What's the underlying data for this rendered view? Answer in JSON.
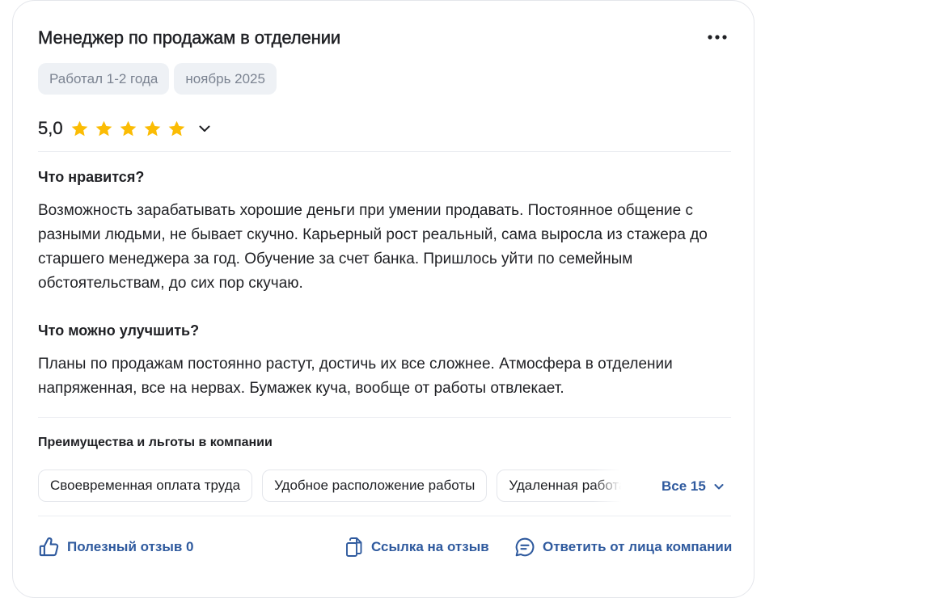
{
  "review": {
    "title": "Менеджер по продажам в отделении",
    "tags": [
      "Работал 1-2 года",
      "ноябрь 2025"
    ],
    "rating": {
      "value": "5,0",
      "stars": 5,
      "star_color": "#fbbc04"
    },
    "pros": {
      "title": "Что нравится?",
      "text": "Возможность зарабатывать хорошие деньги при умении продавать. Постоянное общение с разными людьми, не бывает скучно. Карьерный рост реальный, сама выросла из стажера до старшего менеджера за год. Обучение за счет банка. Пришлось уйти по семейным обстоятельствам, до сих пор скучаю."
    },
    "cons": {
      "title": "Что можно улучшить?",
      "text": "Планы по продажам постоянно растут, достичь их все сложнее. Атмосфера в отделении напряженная, все на нервах. Бумажек куча, вообще от работы отвлекает."
    },
    "benefits": {
      "title": "Преимущества и льготы в компании",
      "items": [
        "Своевременная оплата труда",
        "Удобное расположение работы",
        "Удаленная работа"
      ],
      "show_all_label": "Все 15"
    },
    "actions": {
      "helpful_label": "Полезный отзыв 0",
      "link_label": "Ссылка на отзыв",
      "reply_label": "Ответить от лица компании"
    },
    "icons": {
      "more": "more-horizontal-icon",
      "rating_toggle": "chevron-down-icon",
      "helpful": "thumb-up-icon",
      "link": "copy-link-icon",
      "reply": "chat-bubble-icon"
    },
    "colors": {
      "accent": "#2f5a9e",
      "star": "#fbbc04",
      "tag_bg": "#eef1f5",
      "tag_text": "#7b8391"
    }
  }
}
